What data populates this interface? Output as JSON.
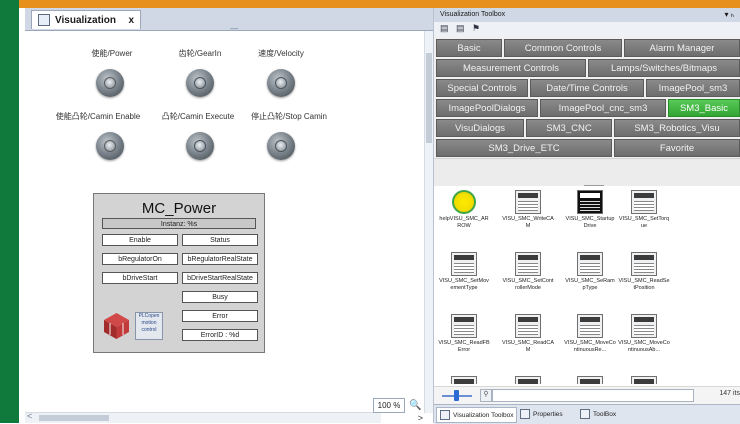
{
  "editor": {
    "tab_label": "Visualization",
    "tab_close": "x",
    "ruler_mark": "—",
    "zoom_level": "100 %",
    "zoom_icon": "🔍",
    "labels": {
      "power": "使能/Power",
      "gearin": "齿轮/GearIn",
      "velocity": "速度/Velocity",
      "camin_enable": "使能凸轮/Camin Enable",
      "camin_execute": "凸轮/Camin Execute",
      "stop_camin": "停止凸轮/Stop Camin"
    },
    "mc_power": {
      "title": "MC_Power",
      "instance": "Instanz: %s",
      "enable": "Enable",
      "status": "Status",
      "bregulatoron": "bRegulatorOn",
      "bregulatorrealstate": "bRegulatorRealState",
      "bdrivestart": "bDriveStart",
      "bdrivestartrealstate": "bDriveStartRealState",
      "busy": "Busy",
      "error": "Error",
      "errorid": "ErrorID : %d",
      "plc_logo_text": "PLCopen motion control"
    }
  },
  "toolbox": {
    "title": "Visualization Toolbox",
    "pin": "▾ ₕ",
    "categories": [
      [
        "Basic",
        "Common Controls",
        "Alarm Manager"
      ],
      [
        "Measurement Controls",
        "Lamps/Switches/Bitmaps"
      ],
      [
        "Special Controls",
        "Date/Time Controls",
        "ImagePool_sm3"
      ],
      [
        "ImagePoolDialogs",
        "ImagePool_cnc_sm3",
        "SM3_Basic"
      ],
      [
        "VisuDialogs",
        "SM3_CNC",
        "SM3_Robotics_Visu"
      ],
      [
        "SM3_Drive_ETC",
        "Favorite"
      ]
    ],
    "active_category": "SM3_Basic",
    "items": [
      "helpVISU_SMC_ARROW",
      "VISU_SMC_WriteCAM",
      "VISU_SMC_StartupDrive",
      "VISU_SMC_SetTorque",
      "VISU_SMC_SetMovementType",
      "VISU_SMC_SetControllerMode",
      "VISU_SMC_SeRampType",
      "VISU_SMC_ReadSetPosition",
      "VISU_SMC_ReadFBError",
      "VISU_SMC_ReadCAM",
      "VISU_SMC_MoveContinuousRe...",
      "VISU_SMC_MoveContinuousAb..."
    ],
    "item_count": "147 its",
    "bottom_tabs": [
      "Visualization Toolbox",
      "Properties",
      "ToolBox"
    ]
  }
}
